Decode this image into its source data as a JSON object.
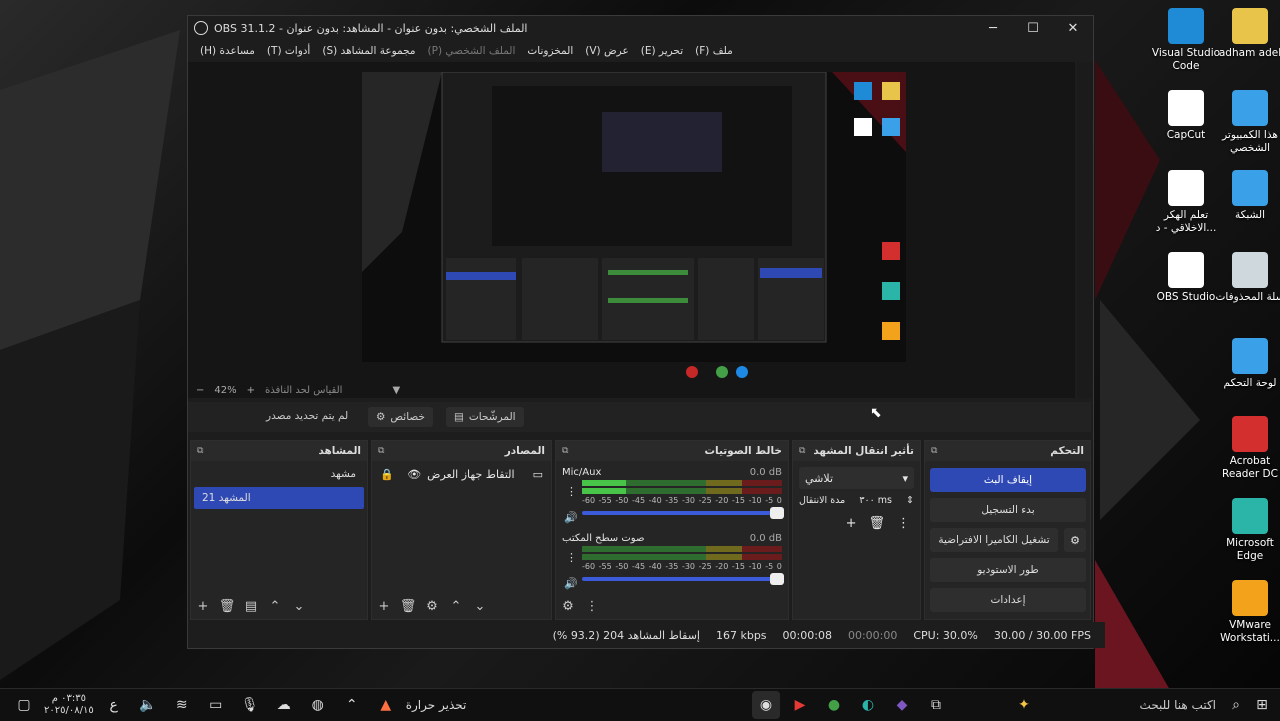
{
  "desktop_icons": [
    {
      "label": "Visual Studio Code",
      "icon": "vscode-icon",
      "color": "#1f8ad6"
    },
    {
      "label": "adham adel",
      "icon": "folder-icon",
      "color": "#e8c44a"
    },
    {
      "label": "CapCut",
      "icon": "capcut-icon",
      "color": "#ffffff"
    },
    {
      "label": "هذا الكمبيوتر الشخصي",
      "icon": "computer-icon",
      "color": "#3aa0e8"
    },
    {
      "label": "تعلم الهكر الاخلاقي - د...",
      "icon": "shortcut-icon",
      "color": "#ffffff"
    },
    {
      "label": "الشبكة",
      "icon": "network-icon",
      "color": "#3aa0e8"
    },
    {
      "label": "OBS Studio",
      "icon": "obs-icon",
      "color": "#ffffff"
    },
    {
      "label": "سلة المحذوفات",
      "icon": "recycle-bin-icon",
      "color": "#cfd8dc"
    },
    {
      "label": "لوحة التحكم",
      "icon": "control-panel-icon",
      "color": "#3aa0e8"
    },
    {
      "label": "Acrobat Reader DC",
      "icon": "acrobat-icon",
      "color": "#d32f2f"
    },
    {
      "label": "Microsoft Edge",
      "icon": "edge-icon",
      "color": "#2bb5a8"
    },
    {
      "label": "VMware Workstati...",
      "icon": "vmware-icon",
      "color": "#f3a21b"
    }
  ],
  "window": {
    "title": "OBS 31.1.2 - الملف الشخصي: بدون عنوان - المشاهد: بدون عنوان",
    "controls": [
      "─",
      "☐",
      "✕"
    ]
  },
  "menu": [
    "ملف (F)",
    "تحرير (E)",
    "عرض (V)",
    "المخزونات",
    "الملف الشخصي (P)",
    "مجموعة المشاهد (S)",
    "أدوات (T)",
    "مساعدة (H)"
  ],
  "zoom": {
    "minus": "−",
    "value": "42%",
    "plus": "+",
    "text": "القياس لحد النافذة"
  },
  "context_bar": {
    "no_source": "لم يتم تحديد مصدر",
    "properties": "خصائص",
    "filters": "المرشّحات"
  },
  "docks": {
    "scenes": {
      "title": "المشاهد",
      "items": [
        "مشهد",
        "المشهد 21"
      ]
    },
    "sources": {
      "title": "المصادر",
      "items": [
        {
          "name": "التقاط جهاز العرض"
        }
      ]
    },
    "mixer": {
      "title": "خالط الصوتيات",
      "channels": [
        {
          "name": "Mic/Aux",
          "db": "0.0 dB",
          "level": 0.22
        },
        {
          "name": "صوت سطح المكتب",
          "db": "0.0 dB",
          "level": 0.0
        }
      ],
      "ticks": [
        "-60",
        "-55",
        "-50",
        "-45",
        "-40",
        "-35",
        "-30",
        "-25",
        "-20",
        "-15",
        "-10",
        "-5",
        "0"
      ]
    },
    "transitions": {
      "title": "تأثير انتقال المشهد",
      "type": "تلاشي",
      "duration_label": "مدة الانتقال",
      "duration_value": "٣٠٠ ms"
    },
    "controls": {
      "title": "التحكم",
      "buttons": [
        "إيقاف البث",
        "بدء التسجيل",
        "تشغيل الكاميرا الافتراضية",
        "طور الاستوديو",
        "إعدادات"
      ]
    }
  },
  "status": {
    "dropped": "إسقاط المشاهد 204 (93.2 %)",
    "bitrate": "167 kbps",
    "stream_time": "00:00:08",
    "rec_time": "00:00:00",
    "cpu": "CPU: 30.0%",
    "fps": "30.00 / 30.00 FPS"
  },
  "taskbar": {
    "search_placeholder": "اكتب هنا للبحث",
    "weather": "تحذير حرارة",
    "time": "٠٣:٣٥ م",
    "date": "٢٠٢٥/٠٨/١٥",
    "lang": "ع"
  },
  "colors": {
    "accent": "#2f49b4",
    "obs_bg": "#1d1d1d",
    "panel": "#252525"
  }
}
